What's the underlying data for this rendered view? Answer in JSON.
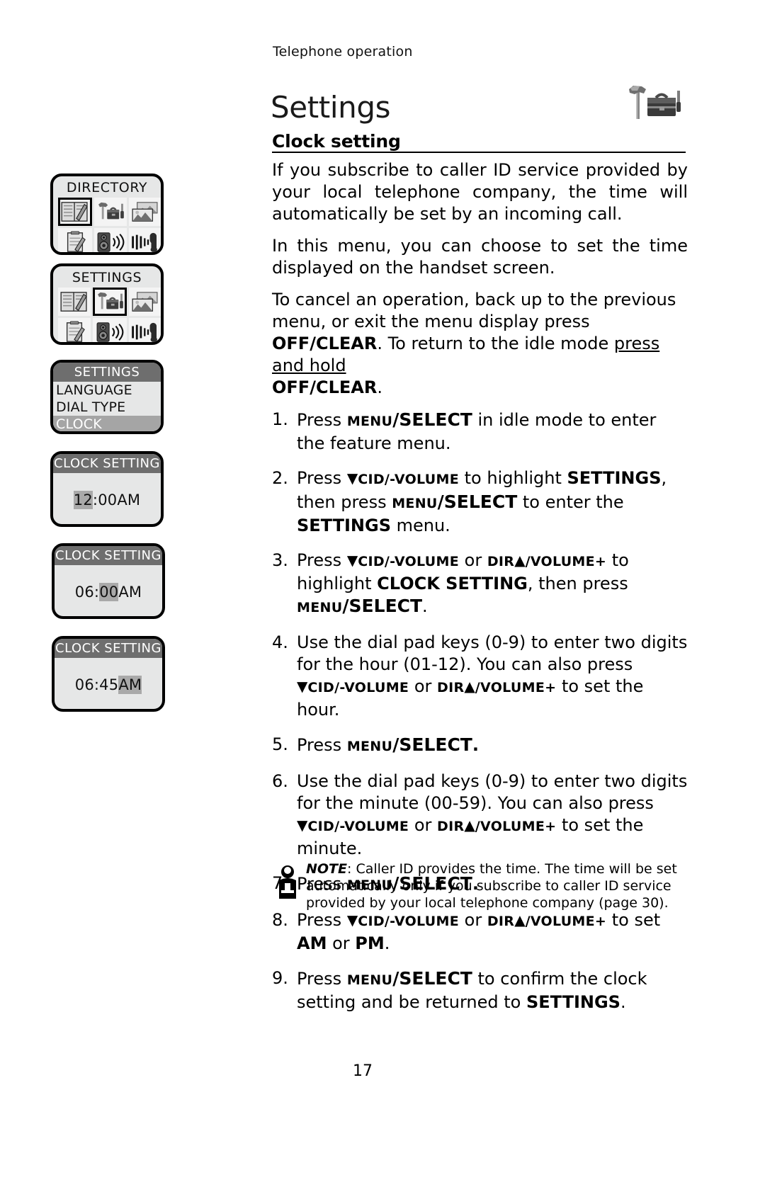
{
  "header": {
    "running_title": "Telephone operation"
  },
  "chapter": {
    "title": "Settings",
    "icon": "hammer-toolbox-icon"
  },
  "section": {
    "heading": "Clock setting"
  },
  "paragraphs": [
    "If you subscribe to caller ID service provided by your local telephone company, the time will automatically be set by an incoming call.",
    "In this menu, you can choose to set the time displayed on the handset screen."
  ],
  "cancel_note": {
    "part1": "To cancel an operation, back up to the previous menu, or exit the menu display press ",
    "bold1": "OFF/CLEAR",
    "part2": ". To return to the idle mode ",
    "underline": "press and hold",
    "bold2": "OFF/CLEAR",
    "part3": "."
  },
  "steps": [
    {
      "num": "1.",
      "text": "Press MENU/SELECT in idle mode to enter the feature menu."
    },
    {
      "num": "2.",
      "text": "Press ▼CID/-VOLUME to highlight SETTINGS, then press MENU/SELECT to enter the SETTINGS menu."
    },
    {
      "num": "3.",
      "text": "Press ▼CID/-VOLUME or DIR▲/VOLUME+ to highlight CLOCK SETTING, then press MENU/SELECT."
    },
    {
      "num": "4.",
      "text": "Use the dial pad keys (0-9) to enter two digits for the hour (01-12). You can also press ▼CID/-VOLUME or DIR▲/VOLUME+ to set the hour."
    },
    {
      "num": "5.",
      "text": "Press MENU/SELECT."
    },
    {
      "num": "6.",
      "text": "Use the dial pad keys (0-9) to enter two digits for the minute (00-59). You can also press ▼CID/-VOLUME or DIR▲/VOLUME+ to set the minute."
    },
    {
      "num": "7.",
      "text": "Press MENU/SELECT."
    },
    {
      "num": "8.",
      "text": "Press ▼CID/-VOLUME or DIR▲/VOLUME+ to set AM or PM."
    },
    {
      "num": "9.",
      "text": "Press MENU/SELECT to confirm the clock setting and be returned to SETTINGS."
    }
  ],
  "step_labels": {
    "press": "Press",
    "menu": "MENU",
    "select": "/SELECT",
    "cid_down": "▼",
    "cid": "CID/-VOLUME",
    "dir": "DIR",
    "dir_up": "▲",
    "volume_plus": "/VOLUME+",
    "settings": "SETTINGS",
    "clock_setting": "CLOCK SETTING",
    "am": "AM",
    "pm": "PM",
    "or": "or"
  },
  "note": {
    "icon": "info-icon",
    "label": "NOTE",
    "text": ": Caller ID provides the time. The time will be set automatically only if you subscribe to caller ID service provided by your local telephone company (page 30)."
  },
  "page_number": "17",
  "lcd_screens": [
    {
      "id": "directory-screen",
      "type": "icon-menu",
      "title": "DIRECTORY",
      "selected_index": 0,
      "icons": [
        "directory-book-icon",
        "hammer-toolbox-icon",
        "photo-gallery-icon",
        "notepad-icon",
        "speaker-ringer-icon",
        "handset-signal-icon"
      ]
    },
    {
      "id": "settings-screen",
      "type": "icon-menu",
      "title": "SETTINGS",
      "selected_index": 1,
      "icons": [
        "directory-book-icon",
        "hammer-toolbox-icon",
        "photo-gallery-icon",
        "notepad-icon",
        "speaker-ringer-icon",
        "handset-signal-icon"
      ]
    },
    {
      "id": "settings-list-screen",
      "type": "list",
      "header": "SETTINGS",
      "rows": [
        {
          "label": "LANGUAGE",
          "highlighted": false
        },
        {
          "label": "DIAL TYPE",
          "highlighted": false
        },
        {
          "label": "CLOCK SETTING",
          "highlighted": true
        }
      ]
    },
    {
      "id": "clock-hour-screen",
      "type": "clock",
      "header": "CLOCK SETTING",
      "time_parts": [
        {
          "text": "12",
          "highlighted": true
        },
        {
          "text": ":00AM",
          "highlighted": false
        }
      ]
    },
    {
      "id": "clock-minute-screen",
      "type": "clock",
      "header": "CLOCK SETTING",
      "time_parts": [
        {
          "text": "06:",
          "highlighted": false
        },
        {
          "text": "00",
          "highlighted": true
        },
        {
          "text": "AM",
          "highlighted": false
        }
      ]
    },
    {
      "id": "clock-ampm-screen",
      "type": "clock",
      "header": "CLOCK SETTING",
      "time_parts": [
        {
          "text": "06:45",
          "highlighted": false
        },
        {
          "text": "AM",
          "highlighted": true
        }
      ]
    }
  ],
  "colors": {
    "lcd_background": "#e6e7e7",
    "lcd_header_bar": "#6e6e6e",
    "lcd_highlight": "#a5a5a5",
    "text": "#000000"
  }
}
